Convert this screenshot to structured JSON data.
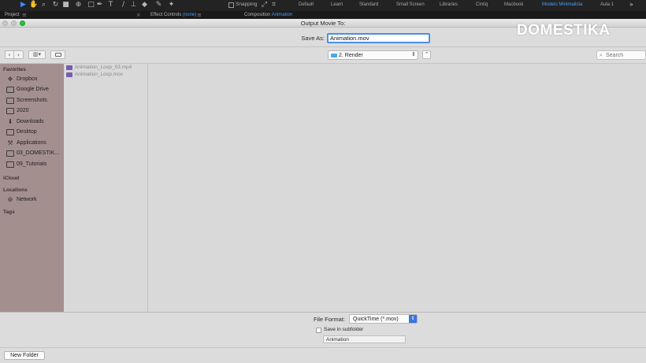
{
  "ae": {
    "workspaces": [
      "Default",
      "Learn",
      "Standard",
      "Small Screen",
      "Libraries",
      "Cintiq",
      "Macbook",
      "Modelo Minimalista",
      "Aula 1"
    ],
    "active_workspace": "Modelo Minimalista",
    "snapping_label": "Snapping",
    "more_glyph": "»",
    "panels": {
      "project": "Project",
      "effect_controls": "Effect Controls",
      "effect_controls_target": "(none)",
      "composition": "Composition",
      "composition_target": "Animation"
    }
  },
  "logo": {
    "text": "DOMESTIKA"
  },
  "dialog": {
    "title": "Output Movie To:",
    "save_as_label": "Save As:",
    "save_as_value": "Animation.mov",
    "location": "2. Render",
    "search_placeholder": "Search",
    "sidebar": {
      "favorites_label": "Favorites",
      "favorites": [
        {
          "label": "Dropbox",
          "icon": "dropbox-icon"
        },
        {
          "label": "Google Drive",
          "icon": "folder-icon"
        },
        {
          "label": "Screenshots",
          "icon": "folder-icon"
        },
        {
          "label": "2020",
          "icon": "folder-icon"
        },
        {
          "label": "Downloads",
          "icon": "downloads-icon"
        },
        {
          "label": "Desktop",
          "icon": "folder-icon"
        },
        {
          "label": "Applications",
          "icon": "applications-icon"
        },
        {
          "label": "03_DOMESTIK...",
          "icon": "folder-icon"
        },
        {
          "label": "09_Tutoriais",
          "icon": "folder-icon"
        }
      ],
      "icloud_label": "iCloud",
      "locations_label": "Locations",
      "locations": [
        {
          "label": "Network",
          "icon": "network-icon"
        }
      ],
      "tags_label": "Tags"
    },
    "files": [
      "Animation_Loop_03.mp4",
      "Animation_Loop.mov"
    ],
    "file_format_label": "File Format:",
    "file_format_value": "QuickTime (*.mov)",
    "save_in_subfolder_label": "Save in subfolder",
    "subfolder_value": "Animation",
    "new_folder_label": "New Folder"
  }
}
